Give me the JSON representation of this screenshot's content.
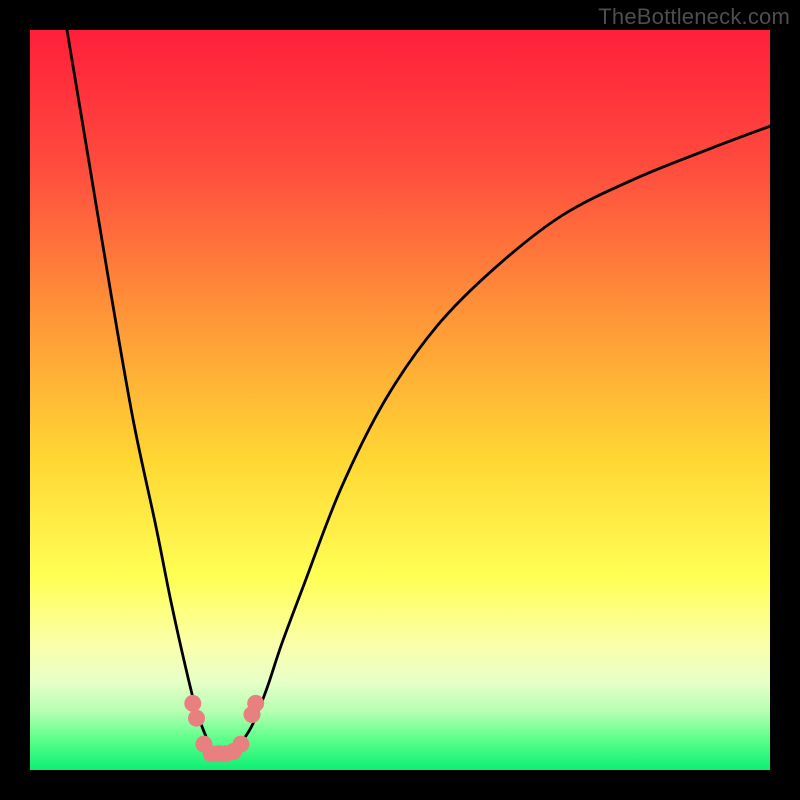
{
  "watermark": {
    "text": "TheBottleneck.com"
  },
  "chart_data": {
    "type": "line",
    "title": "",
    "xlabel": "",
    "ylabel": "",
    "xlim": [
      0,
      100
    ],
    "ylim": [
      0,
      100
    ],
    "gradient_stops": [
      {
        "pct": 0,
        "color": "#ff1f3a"
      },
      {
        "pct": 18,
        "color": "#ff4a3e"
      },
      {
        "pct": 40,
        "color": "#ff9a38"
      },
      {
        "pct": 58,
        "color": "#ffd733"
      },
      {
        "pct": 74,
        "color": "#ffff55"
      },
      {
        "pct": 83,
        "color": "#fbffaa"
      },
      {
        "pct": 88,
        "color": "#e8ffc8"
      },
      {
        "pct": 92,
        "color": "#b7ffb2"
      },
      {
        "pct": 96,
        "color": "#59ff8a"
      },
      {
        "pct": 100,
        "color": "#0bef74"
      }
    ],
    "series": [
      {
        "name": "bottleneck-curve",
        "x": [
          5,
          8,
          11,
          14,
          17,
          19,
          21,
          22.5,
          24,
          25,
          26,
          27,
          28,
          30,
          32,
          34,
          37,
          42,
          48,
          55,
          63,
          72,
          82,
          92,
          100
        ],
        "y": [
          100,
          82,
          64,
          47,
          33,
          23,
          14,
          8,
          4,
          2,
          2,
          2,
          3,
          6,
          11,
          17,
          25,
          38,
          50,
          60,
          68,
          75,
          80,
          84,
          87
        ]
      }
    ],
    "markers": [
      {
        "x": 22.0,
        "y": 9.0
      },
      {
        "x": 22.5,
        "y": 7.0
      },
      {
        "x": 23.5,
        "y": 3.5
      },
      {
        "x": 24.5,
        "y": 2.2
      },
      {
        "x": 25.5,
        "y": 2.2
      },
      {
        "x": 26.5,
        "y": 2.2
      },
      {
        "x": 27.5,
        "y": 2.5
      },
      {
        "x": 28.5,
        "y": 3.5
      },
      {
        "x": 30.0,
        "y": 7.5
      },
      {
        "x": 30.5,
        "y": 9.0
      }
    ]
  }
}
